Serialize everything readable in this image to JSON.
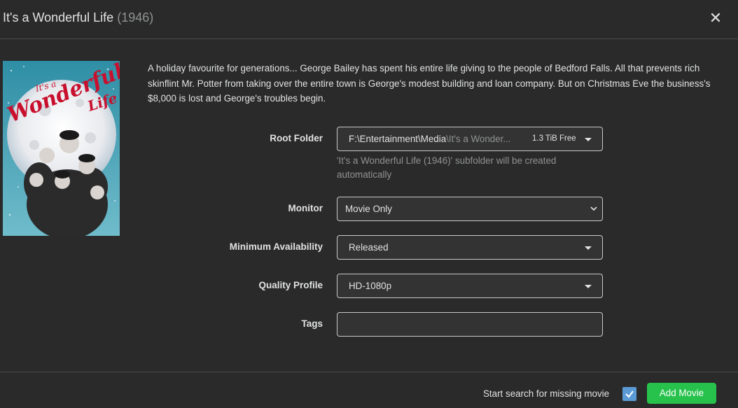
{
  "modal": {
    "title": "It's a Wonderful Life",
    "year": "(1946)",
    "close_icon": "close-icon"
  },
  "poster": {
    "logo_line1": "It's a",
    "logo_line2": "Wonderful",
    "logo_line3": "Life"
  },
  "overview": "A holiday favourite for generations... George Bailey has spent his entire life giving to the people of Bedford Falls. All that prevents rich skinflint Mr. Potter from taking over the entire town is George's modest building and loan company. But on Christmas Eve the business's $8,000 is lost and George's troubles begin.",
  "form": {
    "root_folder": {
      "label": "Root Folder",
      "path": "F:\\Entertainment\\Media",
      "subfolder": "\\It's a Wonder...",
      "free_space": "1.3 TiB Free",
      "help": "'It's a Wonderful Life (1946)' subfolder will be created automatically"
    },
    "monitor": {
      "label": "Monitor",
      "value": "Movie Only"
    },
    "minimum_availability": {
      "label": "Minimum Availability",
      "value": "Released"
    },
    "quality_profile": {
      "label": "Quality Profile",
      "value": "HD-1080p"
    },
    "tags": {
      "label": "Tags",
      "value": ""
    }
  },
  "footer": {
    "search_label": "Start search for missing movie",
    "search_checked": true,
    "add_button": "Add Movie"
  },
  "colors": {
    "background": "#2a2a2a",
    "accent_checkbox": "#5b9bd5",
    "add_button": "#27c24c",
    "muted_text": "#909293"
  }
}
